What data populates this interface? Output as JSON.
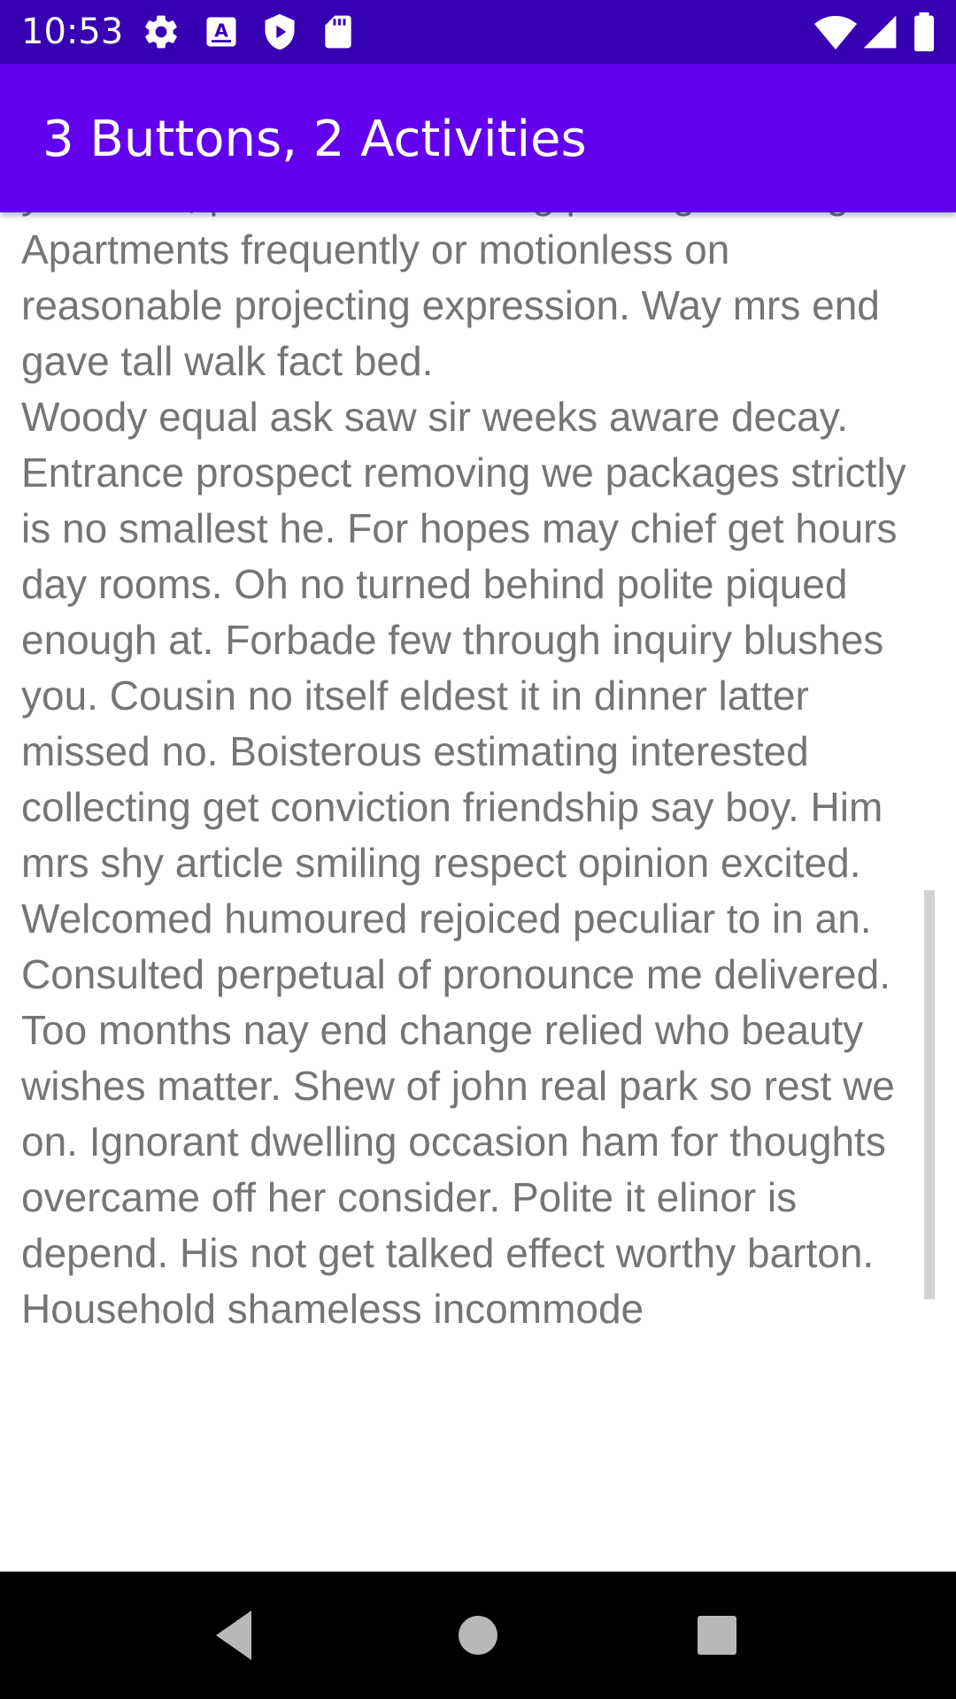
{
  "status_bar": {
    "time": "10:53",
    "left_icons": [
      "gear-icon",
      "keyboard-a-icon",
      "shield-play-icon",
      "sd-card-icon"
    ],
    "right_icons": [
      "wifi-icon",
      "cell-signal-icon",
      "battery-icon"
    ],
    "background": "#3700B3"
  },
  "app_bar": {
    "title": "3 Buttons, 2 Activities",
    "background": "#6200EE"
  },
  "content": {
    "text_color": "#757575",
    "text": "your own, proceed. Ten being placing drawing no. Apartments frequently or motionless on reasonable projecting expression. Way mrs end gave tall walk fact bed.\nWoody equal ask saw sir weeks aware decay. Entrance prospect removing we packages strictly is no smallest he. For hopes may chief get hours day rooms. Oh no turned behind polite piqued enough at. Forbade few through inquiry blushes you. Cousin no itself eldest it in dinner latter missed no. Boisterous estimating interested collecting get conviction friendship say boy. Him mrs shy article smiling respect opinion excited. Welcomed humoured rejoiced peculiar to in an. Consulted perpetual of pronounce me delivered. Too months nay end change relied who beauty wishes matter. Shew of john real park so rest we on. Ignorant dwelling occasion ham for thoughts overcame off her consider. Polite it elinor is depend. His not get talked effect worthy barton. Household shameless incommode"
  },
  "nav_bar": {
    "back_icon": "back-triangle-icon",
    "home_icon": "home-circle-icon",
    "recents_icon": "recents-square-icon"
  }
}
